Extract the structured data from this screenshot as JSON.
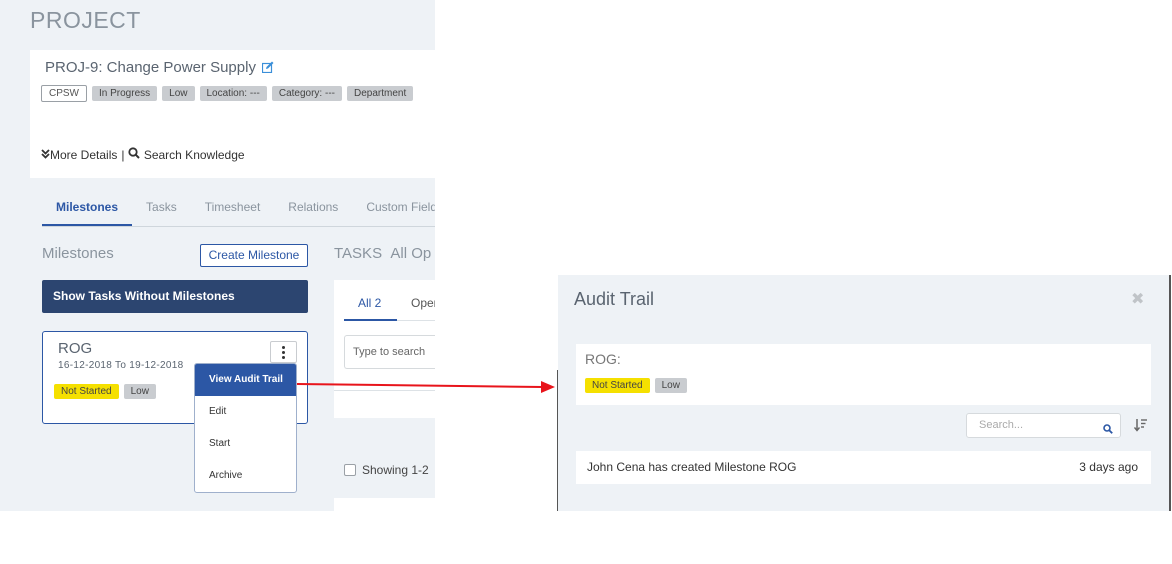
{
  "page": {
    "heading": "PROJECT"
  },
  "project": {
    "title": "PROJ-9: Change Power Supply",
    "tags": [
      "CPSW",
      "In Progress",
      "Low",
      "Location: ---",
      "Category: ---",
      "Department"
    ],
    "more_details": "More Details",
    "separator": "|",
    "search_knowledge": "Search Knowledge"
  },
  "tabs": [
    "Milestones",
    "Tasks",
    "Timesheet",
    "Relations",
    "Custom Field"
  ],
  "milestones": {
    "label": "Milestones",
    "create_button": "Create Milestone",
    "show_tasks_button": "Show Tasks Without Milestones",
    "card": {
      "name": "ROG",
      "dates": "16-12-2018 To 19-12-2018",
      "status": "Not Started",
      "priority": "Low"
    },
    "menu": [
      "View Audit Trail",
      "Edit",
      "Start",
      "Archive"
    ]
  },
  "tasks": {
    "label": "TASKS",
    "filter": "All Op",
    "tab_all": "All 2",
    "tab_open": "Open",
    "search_placeholder": "Type to search",
    "showing": "Showing 1-2"
  },
  "audit": {
    "title": "Audit Trail",
    "close": "✖",
    "milestone_name": "ROG:",
    "status": "Not Started",
    "priority": "Low",
    "search_placeholder": "Search...",
    "entries": [
      {
        "text": "John Cena has created Milestone ROG",
        "time": "3 days ago"
      }
    ]
  },
  "colors": {
    "accent": "#2c57a5",
    "dark_button": "#2c4570",
    "status_yellow": "#f5e000",
    "arrow": "#e8141b",
    "panel_bg": "#eef2f6"
  }
}
